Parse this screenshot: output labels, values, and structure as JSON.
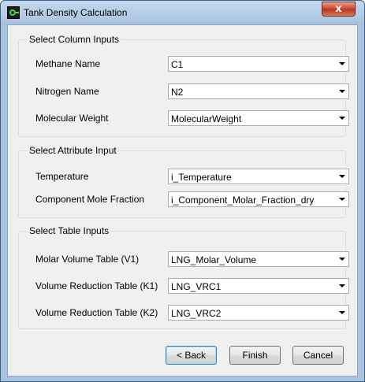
{
  "window": {
    "title": "Tank Density Calculation",
    "close_glyph": "x"
  },
  "groups": {
    "column": {
      "label": "Select Column Inputs",
      "fields": [
        {
          "label": "Methane Name",
          "value": "C1"
        },
        {
          "label": "Nitrogen Name",
          "value": "N2"
        },
        {
          "label": "Molecular Weight",
          "value": "MolecularWeight"
        }
      ]
    },
    "attribute": {
      "label": "Select Attribute Input",
      "fields": [
        {
          "label": "Temperature",
          "value": "i_Temperature"
        },
        {
          "label": "Component Mole Fraction",
          "value": "i_Component_Molar_Fraction_dry"
        }
      ]
    },
    "table": {
      "label": "Select Table Inputs",
      "fields": [
        {
          "label": "Molar Volume Table (V1)",
          "value": "LNG_Molar_Volume"
        },
        {
          "label": "Volume Reduction Table (K1)",
          "value": "LNG_VRC1"
        },
        {
          "label": "Volume Reduction Table (K2)",
          "value": "LNG_VRC2"
        }
      ]
    }
  },
  "buttons": {
    "back": "< Back",
    "finish": "Finish",
    "cancel": "Cancel"
  },
  "icons": {
    "app": "tank-app-icon",
    "close": "close-icon",
    "dropdown": "chevron-down-icon"
  }
}
